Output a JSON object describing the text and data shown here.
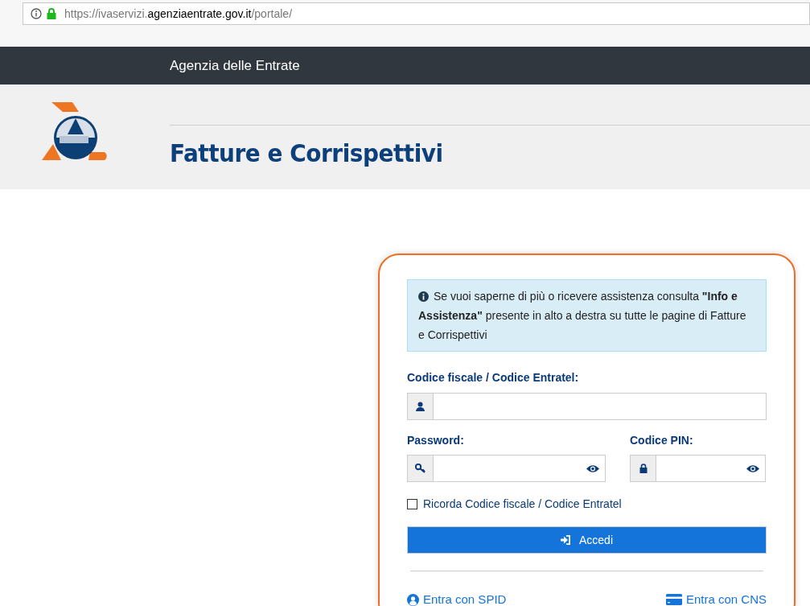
{
  "browser": {
    "url_prefix": "https://ivaservizi.",
    "url_domain": "agenziaentrate.gov.it",
    "url_path": "/portale/"
  },
  "top_bar": {
    "title": "Agenzia delle Entrate"
  },
  "header": {
    "title": "Fatture e Corrispettivi"
  },
  "login": {
    "info": "Se vuoi saperne di più o ricevere assistenza consulta **\"Info e Assistenza\"** presente in alto a destra su tutte le pagine di Fatture e Corrispettivi",
    "fiscal_code": {
      "label": "Codice fiscale / Codice Entratel:"
    },
    "password": {
      "label": "Password:"
    },
    "pin": {
      "label": "Codice PIN:"
    },
    "remember": {
      "label": "Ricorda Codice fiscale / Codice Entratel",
      "checked": false
    },
    "submit": "Accedi",
    "links": [
      {
        "kind": "spid",
        "label": "Entra con SPID"
      },
      {
        "kind": "cns",
        "label": "Entra con CNS"
      }
    ]
  }
}
